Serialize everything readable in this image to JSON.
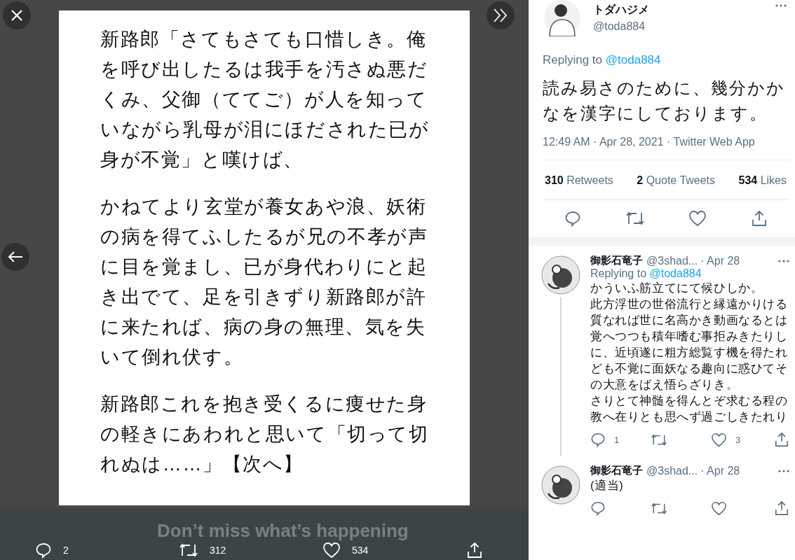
{
  "image": {
    "paragraphs": [
      [
        "新路郎「さてもさても口惜しき。俺",
        "を呼び出したるは我手を汚さぬ悪だ",
        "くみ、父御（ててご）が人を知って",
        "いながら乳母が泪にほだされた已が",
        "身が不覚」と嘆けば、"
      ],
      [
        "かねてより玄堂が養女あや浪、妖術",
        "の病を得てふしたるが兄の不孝が声",
        "に目を覚まし、已が身代わりにと起",
        "き出でて、足を引きずり新路郎が許",
        "に来たれば、病の身の無理、気を失",
        "いて倒れ伏す。"
      ],
      [
        "新路郎これを抱き受くるに痩せた身",
        "の軽きにあわれと思いて「切って切",
        "れぬは……」【次へ】"
      ]
    ]
  },
  "banner": {
    "title": "Don’t miss what’s happening"
  },
  "media_actions": [
    {
      "kind": "reply",
      "count": "2"
    },
    {
      "kind": "retweet",
      "count": "312"
    },
    {
      "kind": "like",
      "count": "534"
    },
    {
      "kind": "share"
    }
  ],
  "tweet": {
    "name": "トダハジメ",
    "handle": "@toda884",
    "replying_label": "Replying to",
    "replying_handle": "@toda884",
    "text": "読み易さのために、幾分かかなを漢字にしております。",
    "meta": "12:49 AM · Apr 28, 2021 · Twitter Web App",
    "stats": [
      {
        "count": "310",
        "label": "Retweets"
      },
      {
        "count": "2",
        "label": "Quote Tweets"
      },
      {
        "count": "534",
        "label": "Likes"
      }
    ],
    "actions": [
      {
        "kind": "reply"
      },
      {
        "kind": "retweet"
      },
      {
        "kind": "like"
      },
      {
        "kind": "share"
      }
    ]
  },
  "replies": [
    {
      "name": "御影石竜子",
      "handle": "@3shad...",
      "date": "· Apr 28",
      "replying_label": "Replying to",
      "replying_handle": "@toda884",
      "paragraphs": [
        "かういふ筋立てにて候ひしか。",
        "此方浮世の世俗流行と縁遠かりける質なれば世に名高かき動画なるとは覚へつつも積年嗜む事拒みきたりしに、近頃遂に粗方総覧す機を得たれども不覚に面妖なる趣向に惑ひてその大意をばえ悟らざりき。",
        "さりとて神髄を得んとぞ求むる程の教へ在りとも思へず過ごしきたれり"
      ],
      "actions": [
        {
          "kind": "reply",
          "count": "1"
        },
        {
          "kind": "retweet"
        },
        {
          "kind": "like",
          "count": "3"
        },
        {
          "kind": "share"
        }
      ]
    },
    {
      "name": "御影石竜子",
      "handle": "@3shad...",
      "date": "· Apr 28",
      "paragraphs": [
        "(適当)"
      ],
      "actions": [
        {
          "kind": "reply"
        },
        {
          "kind": "retweet"
        },
        {
          "kind": "like"
        },
        {
          "kind": "share"
        }
      ]
    }
  ]
}
